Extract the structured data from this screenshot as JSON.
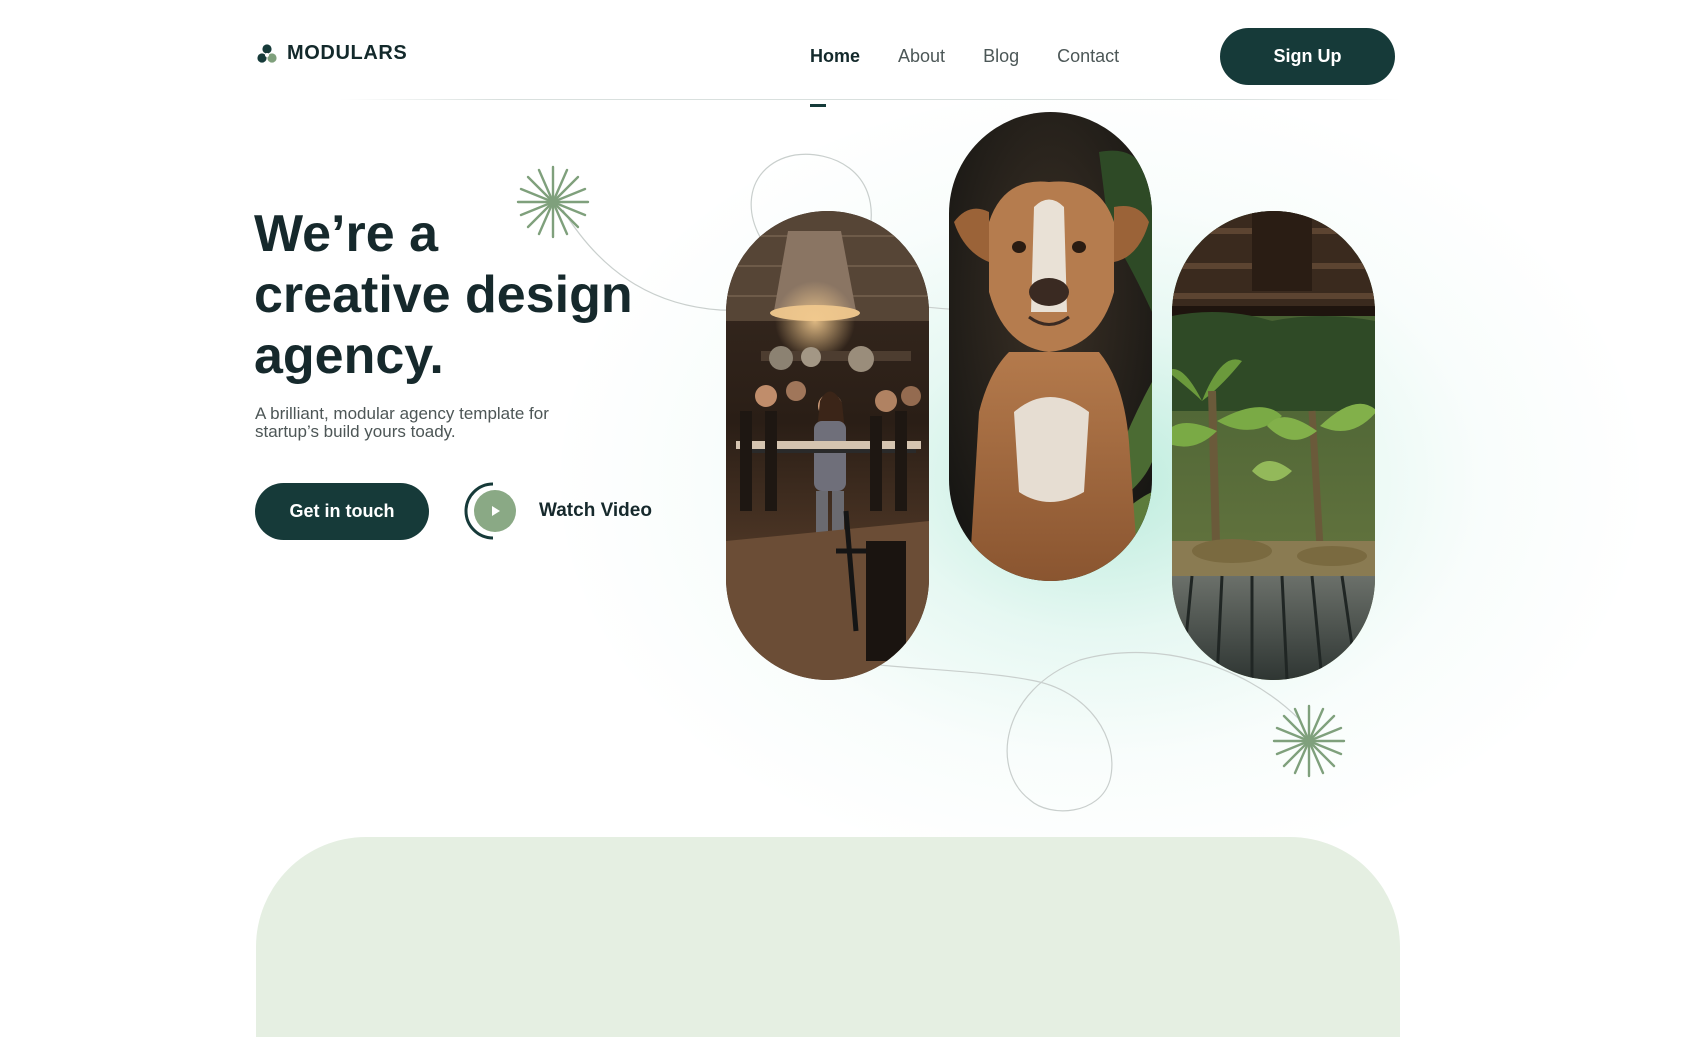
{
  "brand": {
    "name": "MODULARS",
    "logo_icon": "clover-logo-icon",
    "color": "#163a39"
  },
  "nav": {
    "items": [
      {
        "label": "Home",
        "active": true
      },
      {
        "label": "About",
        "active": false
      },
      {
        "label": "Blog",
        "active": false
      },
      {
        "label": "Contact",
        "active": false
      }
    ],
    "signup_label": "Sign Up"
  },
  "hero": {
    "title_lines": [
      "We’re a",
      "creative design",
      "agency."
    ],
    "subtitle_lines": [
      "A brilliant, modular agency template for",
      "startup’s build yours toady."
    ],
    "primary_cta": "Get in touch",
    "video_cta": "Watch Video"
  },
  "images": [
    {
      "name": "concert-photo",
      "subject": "band performing on stage"
    },
    {
      "name": "dog-photo",
      "subject": "brown dog portrait"
    },
    {
      "name": "garden-photo",
      "subject": "banana plants seen from wooden porch"
    }
  ],
  "colors": {
    "accent": "#163a39",
    "sage": "#7fa07c",
    "band": "#e5efe2",
    "glow": "#b0e8d6"
  }
}
